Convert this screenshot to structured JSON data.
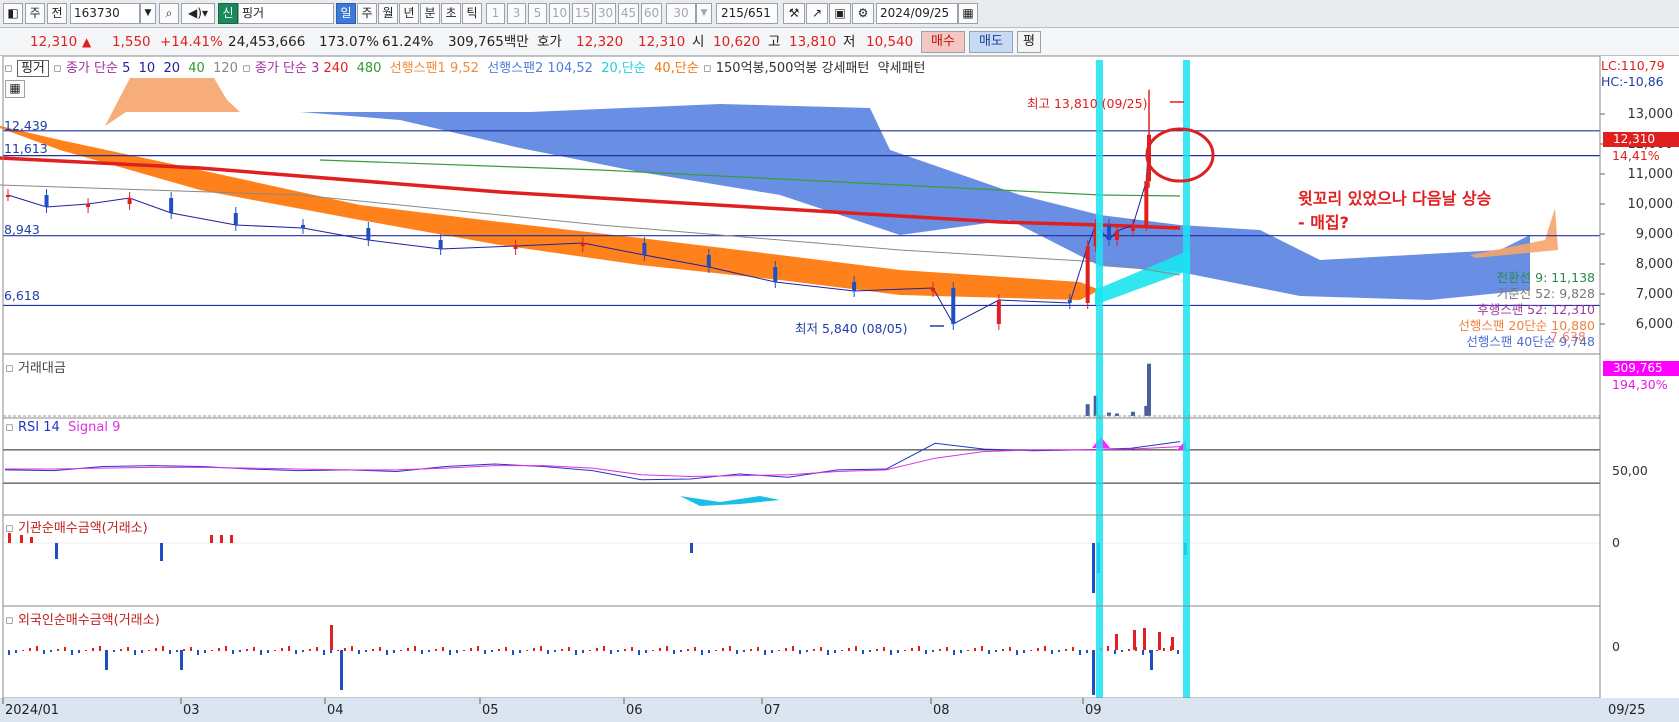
{
  "toolbar": {
    "period_short": "주",
    "prev": "전",
    "code": "163730",
    "tag_new": "신",
    "name": "핑거",
    "periods": [
      "일",
      "주",
      "월",
      "년",
      "분",
      "초",
      "틱"
    ],
    "minutes": [
      "1",
      "3",
      "5",
      "10",
      "15",
      "30",
      "45",
      "60"
    ],
    "interval_value": "30",
    "count_display": "215",
    "count_total": "/651",
    "date": "2024/09/25"
  },
  "quote": {
    "price": "12,310",
    "arrow": "▲",
    "change": "1,550",
    "change_pct": "+14.41%",
    "volume": "24,453,666",
    "vol_ratio": "173.07%",
    "turnover_pct": "61.24%",
    "amount": "309,765백만",
    "ask_label": "호가",
    "ask": "12,320",
    "bid": "12,310",
    "open_label": "시",
    "open": "10,620",
    "high_label": "고",
    "high": "13,810",
    "low_label": "저",
    "low": "10,540",
    "buy_label": "매수",
    "sell_label": "매도",
    "eval_label": "평"
  },
  "legend": {
    "name_tag": "핑거",
    "ma_label": "종가 단순",
    "ma_periods": [
      "5",
      "10",
      "20",
      "40",
      "120"
    ],
    "ma3_label": "종가 단순 3",
    "ma3_periods": [
      "240",
      "480"
    ],
    "span1": "선행스팬1 9,52",
    "span2": "선행스팬2 104,52",
    "s20": "20,단순",
    "s40": "40,단순",
    "pattern": "150억봉,500억봉 강세패턴",
    "weak": "약세패턴"
  },
  "colors": {
    "up": "#e02020",
    "down": "#1f4fc2",
    "cloud": "#4f7be0",
    "cloud_orange": "#f5a46a",
    "ma5": "#2020a0",
    "ma10": "#a020a0",
    "ma20": "#20b0a0",
    "ma40": "#ff7a10",
    "ma240": "#e02020",
    "ma480": "#3a9a3a",
    "cyan": "#19e3f0",
    "rsi": "#2235c8",
    "signal": "#e030e0"
  },
  "right_labels": {
    "lc": "LC:110,79",
    "hc": "HC:-10,86",
    "price_tag": "12,310",
    "pct_tag": "14,41%",
    "amount_tag": "309,765",
    "amount_pct": "194,30%",
    "ichimoku": [
      {
        "text": "전환선 9: 11,138",
        "color": "#2a8a4a"
      },
      {
        "text": "기준선 52: 9,828",
        "color": "#777777"
      },
      {
        "text": "후행스팬 52: 12,310",
        "color": "#9a3aa0"
      },
      {
        "text": "선행스팬 20단순 10,880",
        "color": "#f08040"
      },
      {
        "text": "선행스팬 40단순 9,748",
        "color": "#4f6fd0"
      }
    ],
    "hidden_tail": "7,638"
  },
  "level_labels": {
    "l1": "12,439",
    "l2": "11,613",
    "l3": "8,943",
    "l4": "6,618"
  },
  "annotations": {
    "high": "최고 13,810 (09/25)",
    "low": "최저 5,840 (08/05)",
    "comment_line1": "윗꼬리 있었으나 다음날 상승",
    "comment_line2": "- 매집?"
  },
  "panels": {
    "amount_title": "거래대금",
    "rsi_title": "RSI 14",
    "rsi_signal": "Signal 9",
    "rsi_level": "50,00",
    "inst_title": "기관순매수금액(거래소)",
    "inst_zero": "0",
    "foreign_title": "외국인순매수금액(거래소)",
    "foreign_zero": "0"
  },
  "x_axis": {
    "labels": [
      "2024/01",
      "03",
      "04",
      "05",
      "06",
      "07",
      "08",
      "09"
    ],
    "end_label": "09/25"
  },
  "chart_data": {
    "type": "line",
    "title": "",
    "ylabel": "",
    "ylim": [
      5000,
      14800
    ],
    "y_ticks": [
      6000,
      7000,
      8000,
      9000,
      10000,
      11000,
      12000,
      13000
    ],
    "y_tick_labels": [
      "6,000",
      "7,000",
      "8,000",
      "9,000",
      "10,000",
      "11,000",
      "12,000",
      "13,000"
    ],
    "horizontal_levels": [
      12439,
      11613,
      8943,
      6618
    ],
    "months": [
      "2024/01",
      "03",
      "04",
      "05",
      "06",
      "07",
      "08",
      "09"
    ],
    "series": [
      {
        "name": "종가",
        "x": [
          "01/02",
          "01/15",
          "01/29",
          "02/13",
          "02/27",
          "03/12",
          "03/26",
          "04/09",
          "04/23",
          "05/08",
          "05/22",
          "06/05",
          "06/19",
          "07/03",
          "07/17",
          "07/31",
          "08/05",
          "08/14",
          "08/28",
          "09/02",
          "09/05",
          "09/10",
          "09/13",
          "09/19",
          "09/24",
          "09/25"
        ],
        "values": [
          10300,
          9900,
          10000,
          10200,
          9700,
          9300,
          9200,
          8800,
          8500,
          8600,
          8700,
          8300,
          7900,
          7400,
          7100,
          7200,
          6000,
          6800,
          6700,
          8600,
          9300,
          8800,
          9100,
          9300,
          10760,
          12310
        ]
      },
      {
        "name": "거래대금",
        "x": [
          "09/02",
          "09/05",
          "09/10",
          "09/13",
          "09/19",
          "09/24",
          "09/25"
        ],
        "values": [
          70,
          120,
          20,
          15,
          25,
          60,
          310
        ]
      }
    ],
    "rsi": [
      {
        "name": "RSI 14",
        "values": [
          46,
          45,
          50,
          51,
          50,
          47,
          45,
          46,
          44,
          50,
          53,
          50,
          45,
          34,
          35,
          41,
          37,
          46,
          47,
          78,
          71,
          69,
          70,
          72,
          80
        ]
      },
      {
        "name": "Signal 9",
        "values": [
          47,
          47,
          48,
          49,
          49,
          48,
          47,
          46,
          46,
          48,
          51,
          51,
          48,
          40,
          38,
          39,
          40,
          44,
          46,
          60,
          68,
          70,
          70,
          71,
          74
        ]
      }
    ]
  }
}
